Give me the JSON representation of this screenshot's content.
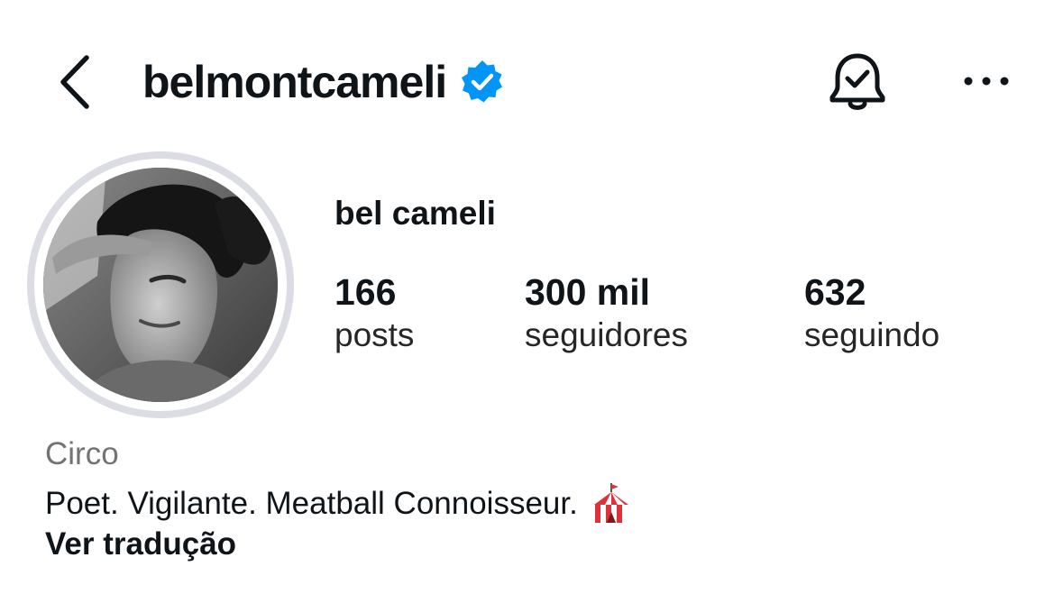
{
  "header": {
    "username": "belmontcameli",
    "back_icon": "chevron-left-icon",
    "verified_icon": "verified-badge-icon",
    "notifications_icon": "bell-icon",
    "more_icon": "more-horizontal-icon"
  },
  "profile": {
    "display_name": "bel cameli",
    "stats": [
      {
        "value": "166",
        "label": "posts"
      },
      {
        "value": "300 mil",
        "label": "seguidores"
      },
      {
        "value": "632",
        "label": "seguindo"
      }
    ],
    "category": "Circo",
    "bio": "Poet. Vigilante. Meatball Connoisseur.",
    "bio_emoji_icon": "circus-tent-icon",
    "translate_label": "Ver tradução"
  },
  "colors": {
    "verified": "#0095f6",
    "text": "#0f1419",
    "secondary_text": "#737373",
    "avatar_ring": "#dcdde4"
  }
}
